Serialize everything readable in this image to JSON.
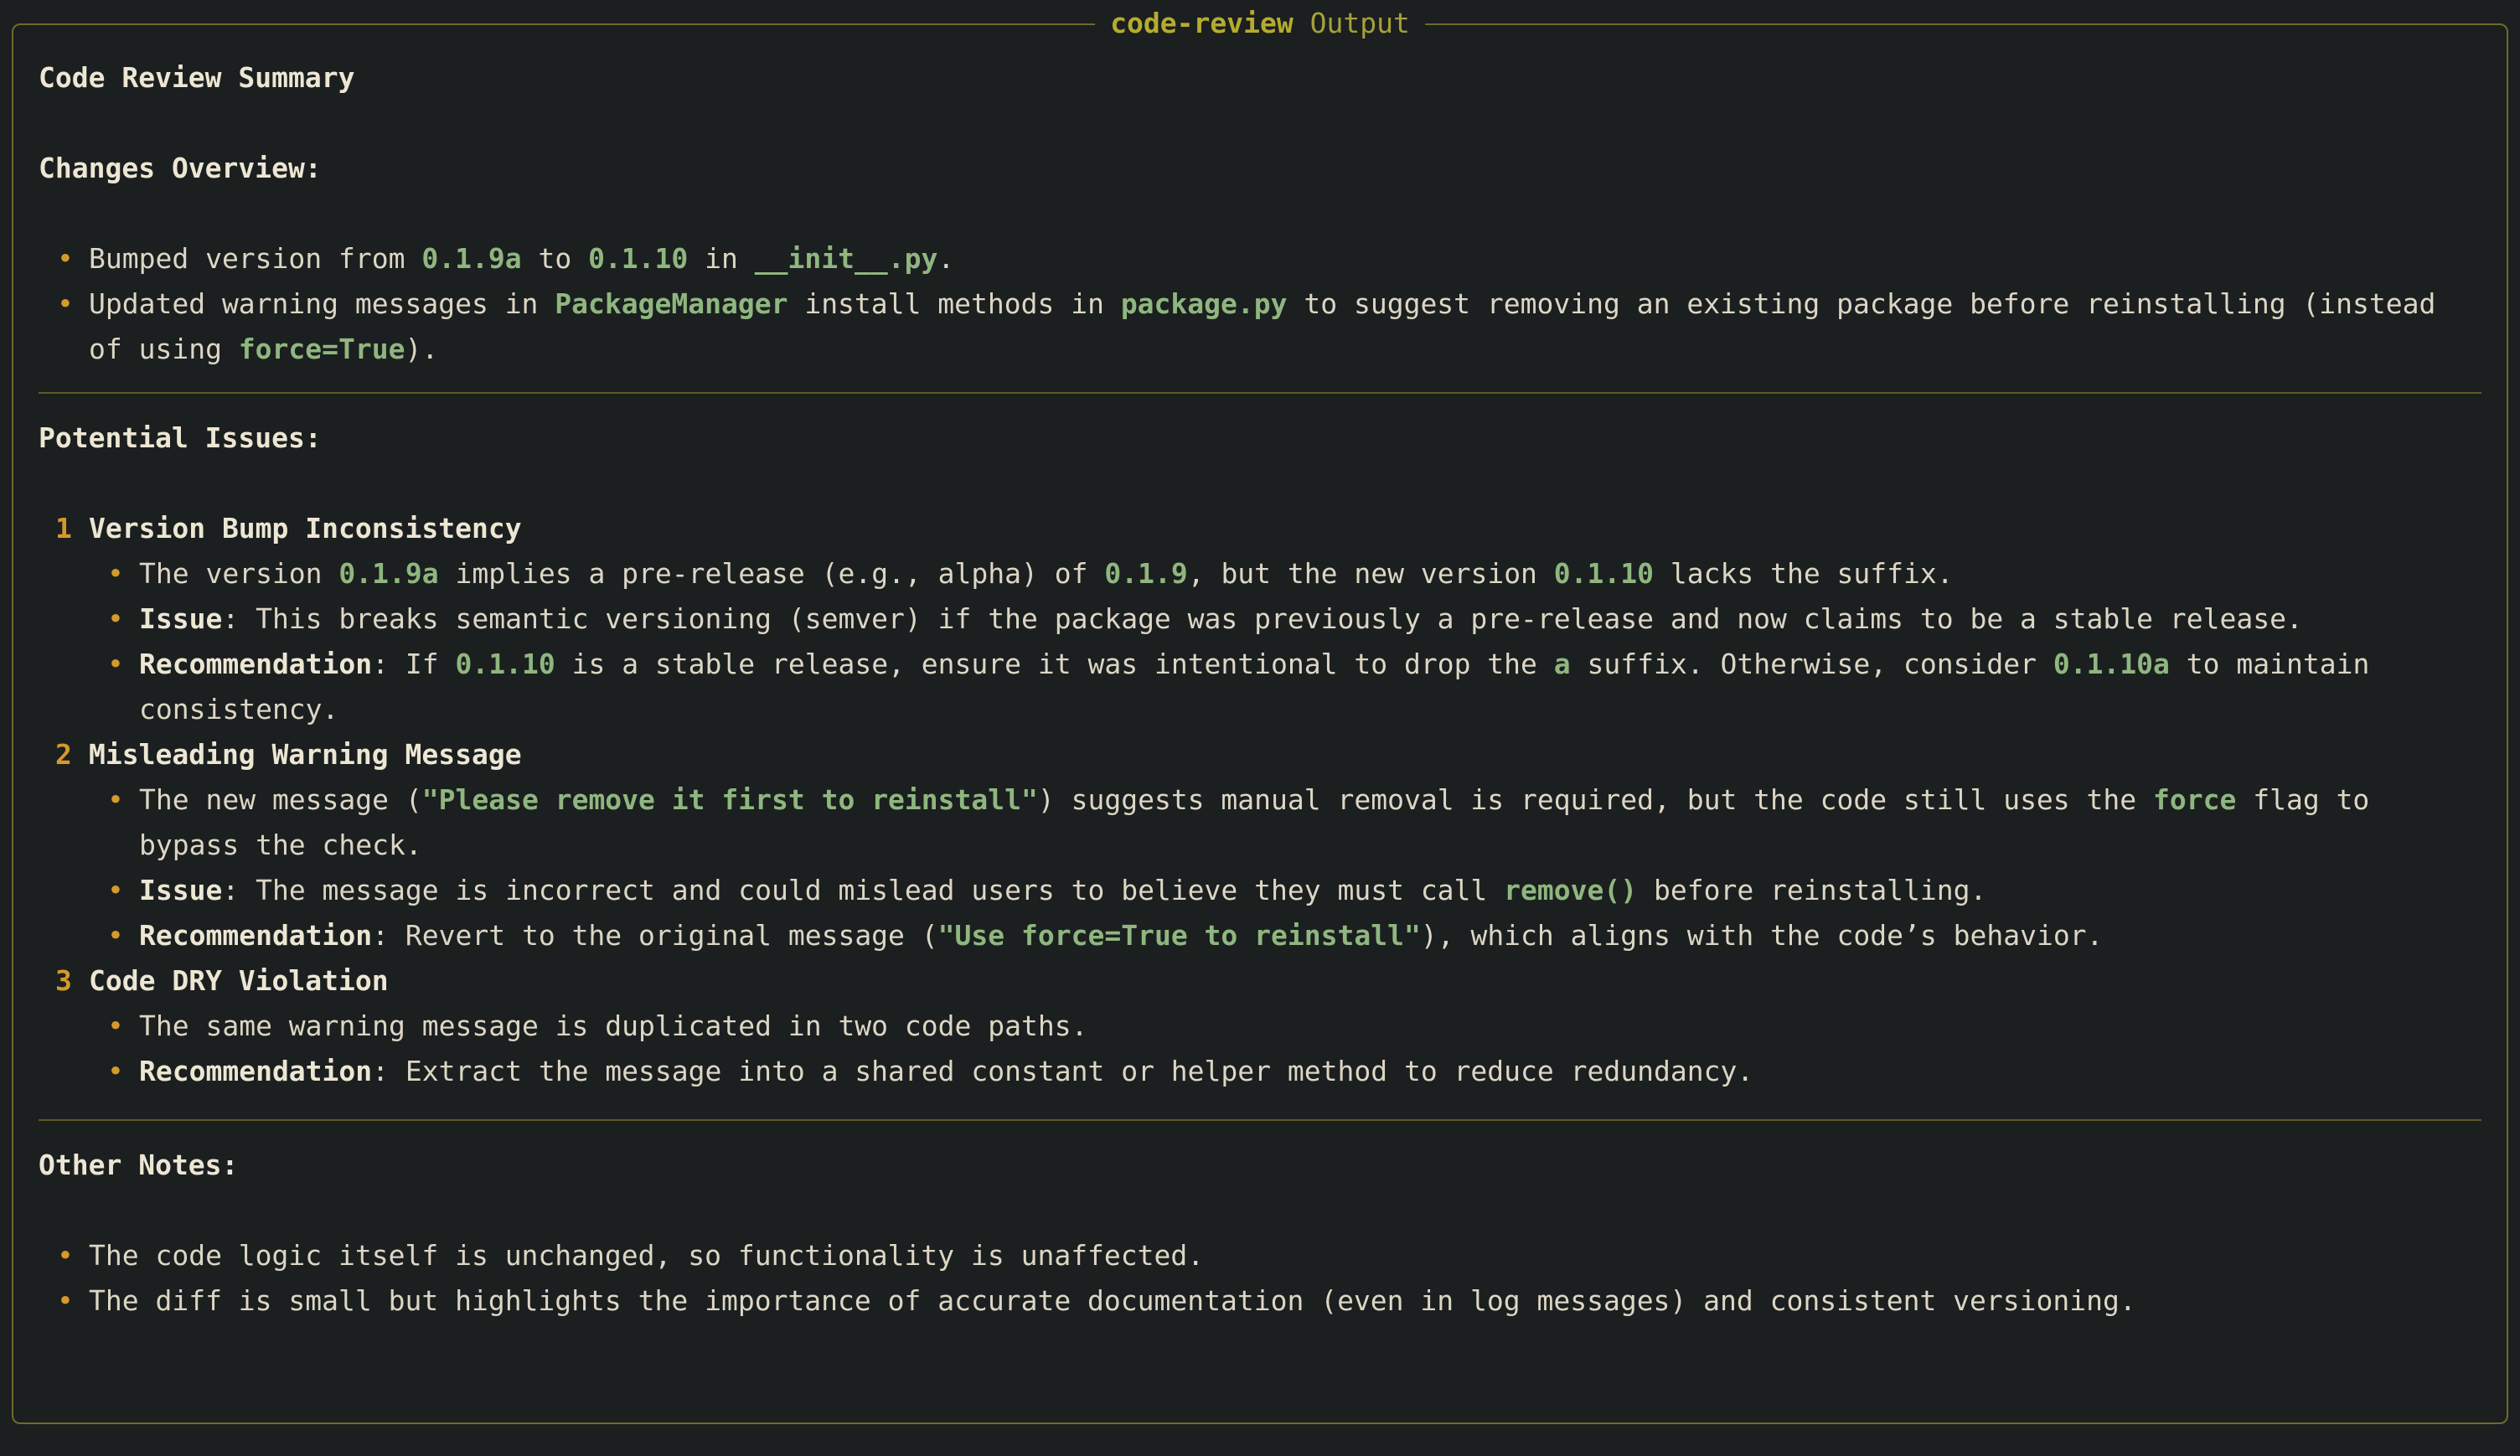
{
  "panel": {
    "title_bold": "code-review",
    "title_rest": " Output"
  },
  "summary_title": "Code Review Summary",
  "changes": {
    "heading": "Changes Overview:",
    "b1": {
      "t1": "Bumped version from ",
      "c1": "0.1.9a",
      "t2": " to ",
      "c2": "0.1.10",
      "t3": " in ",
      "c3": "__init__.py",
      "t4": "."
    },
    "b2": {
      "t1": "Updated warning messages in ",
      "c1": "PackageManager",
      "t2": " install methods in ",
      "c2": "package.py",
      "t3": " to suggest removing an existing package before reinstalling (instead",
      "t4": "of using ",
      "c3": "force=True",
      "t5": ")."
    }
  },
  "issues": {
    "heading": "Potential Issues:",
    "i1": {
      "num": "1",
      "title": "Version Bump Inconsistency",
      "s1": {
        "t1": "The version ",
        "c1": "0.1.9a",
        "t2": " implies a pre-release (e.g., alpha) of ",
        "c2": "0.1.9",
        "t3": ", but the new version ",
        "c3": "0.1.10",
        "t4": " lacks the suffix."
      },
      "s2": {
        "b": "Issue",
        "t1": ": This breaks semantic versioning (semver) if the package was previously a pre-release and now claims to be a stable release."
      },
      "s3": {
        "b": "Recommendation",
        "t1": ": If ",
        "c1": "0.1.10",
        "t2": " is a stable release, ensure it was intentional to drop the ",
        "c2": "a",
        "t3": " suffix. Otherwise, consider ",
        "c3": "0.1.10a",
        "t4": " to maintain",
        "t5": "consistency."
      }
    },
    "i2": {
      "num": "2",
      "title": "Misleading Warning Message",
      "s1": {
        "t1": "The new message (",
        "c1": "\"Please remove it first to reinstall\"",
        "t2": ") suggests manual removal is required, but the code still uses the ",
        "c2": "force",
        "t3": " flag to",
        "t4": "bypass the check."
      },
      "s2": {
        "b": "Issue",
        "t1": ": The message is incorrect and could mislead users to believe they must call ",
        "c1": "remove()",
        "t2": " before reinstalling."
      },
      "s3": {
        "b": "Recommendation",
        "t1": ": Revert to the original message (",
        "c1": "\"Use force=True to reinstall\"",
        "t2": "), which aligns with the code’s behavior."
      }
    },
    "i3": {
      "num": "3",
      "title": "Code DRY Violation",
      "s1": {
        "t1": "The same warning message is duplicated in two code paths."
      },
      "s2": {
        "b": "Recommendation",
        "t1": ": Extract the message into a shared constant or helper method to reduce redundancy."
      }
    }
  },
  "notes": {
    "heading": "Other Notes:",
    "b1": "The code logic itself is unchanged, so functionality is unaffected.",
    "b2": "The diff is small but highlights the importance of accurate documentation (even in log messages) and consistent versioning."
  },
  "glyphs": {
    "bullet": "•"
  },
  "colors": {
    "background": "#1b1f20",
    "border": "#6f6a2a",
    "code": "#8fb67f",
    "bullet": "#d49a2a",
    "text": "#dcd6c4"
  }
}
